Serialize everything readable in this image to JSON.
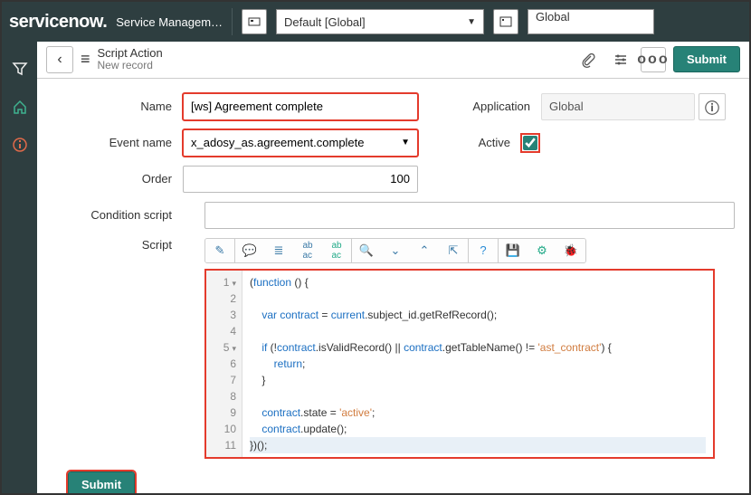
{
  "topbar": {
    "logo": "servicenow",
    "app_title": "Service Managem…",
    "scope_select": "Default [Global]",
    "domain_select": "Global"
  },
  "header": {
    "title": "Script Action",
    "subtitle": "New record",
    "submit_label": "Submit"
  },
  "form": {
    "name_label": "Name",
    "name_value": "[ws] Agreement complete",
    "event_label": "Event name",
    "event_value": "x_adosy_as.agreement.complete",
    "order_label": "Order",
    "order_value": "100",
    "condition_label": "Condition script",
    "condition_value": "",
    "script_label": "Script",
    "application_label": "Application",
    "application_value": "Global",
    "active_label": "Active",
    "active_checked": true
  },
  "code_lines": [
    "(function () {",
    "",
    "    var contract = current.subject_id.getRefRecord();",
    "",
    "    if (!contract.isValidRecord() || contract.getTableName() != 'ast_contract') {",
    "        return;",
    "    }",
    "",
    "    contract.state = 'active';",
    "    contract.update();",
    "})();"
  ],
  "footer": {
    "submit_label": "Submit"
  }
}
